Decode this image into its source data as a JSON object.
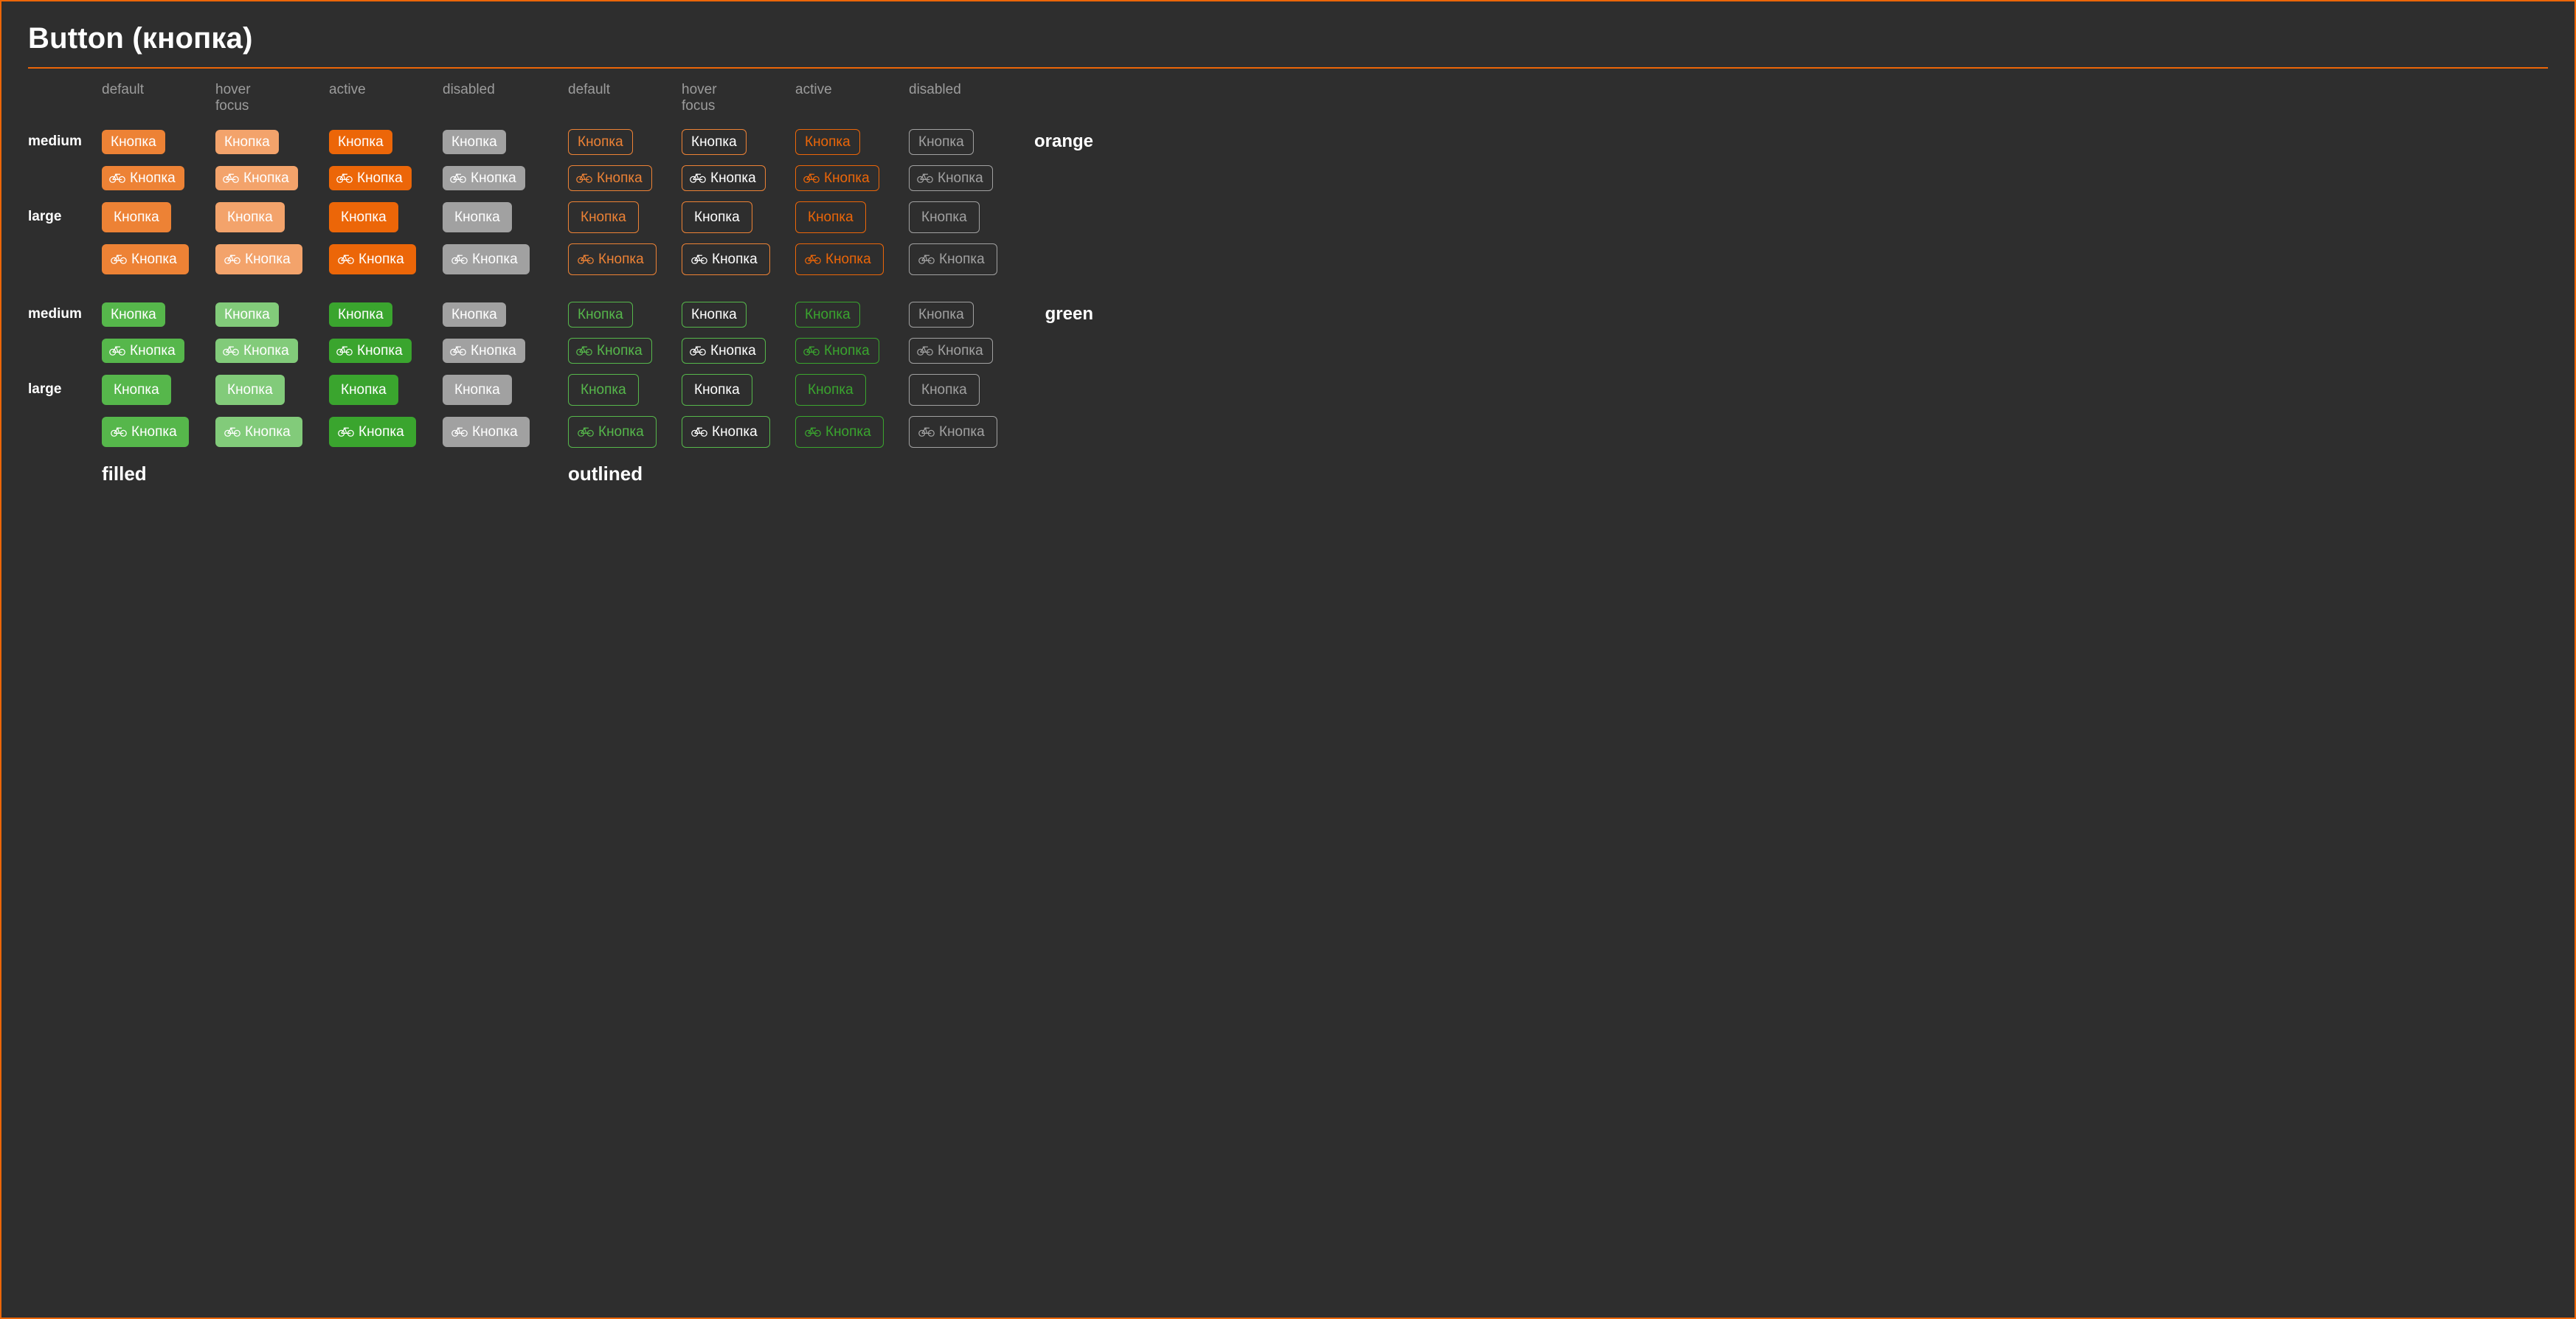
{
  "title": "Button (кнопка)",
  "states": [
    "default",
    "hover\nfocus",
    "active",
    "disabled"
  ],
  "state_keys": [
    "default",
    "hover",
    "active",
    "disabled"
  ],
  "sizes": [
    "medium",
    "large"
  ],
  "colors": [
    "orange",
    "green"
  ],
  "variants": [
    "filled",
    "outlined"
  ],
  "button_label": "Кнопка",
  "icon": "bicycle-icon",
  "palette": {
    "orange_default": "#ed8235",
    "orange_hover": "#f3a36b",
    "orange_active": "#ec6608",
    "green_default": "#56b74b",
    "green_hover": "#82cb7a",
    "green_active": "#3aa52e",
    "disabled": "#a1a1a1",
    "bg": "#2e2e2e",
    "border": "#ec6608"
  }
}
